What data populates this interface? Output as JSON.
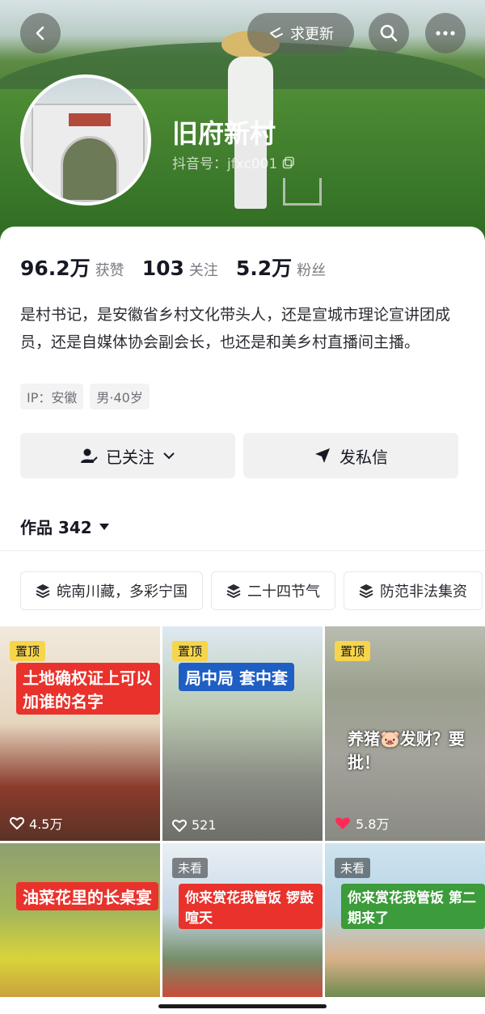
{
  "header": {
    "update_label": "求更新",
    "name": "旧府新村",
    "douyin_id": "抖音号：jfxc001"
  },
  "stats": [
    {
      "num": "96.2万",
      "label": "获赞"
    },
    {
      "num": "103",
      "label": "关注"
    },
    {
      "num": "5.2万",
      "label": "粉丝"
    }
  ],
  "bio": {
    "text": "是村书记，是安徽省乡村文化带头人，还是宣城市理论宣讲团成员，还是自媒体协会副会长，也还是和美乡村直播间主播。",
    "tags": [
      "IP：安徽",
      "男·40岁"
    ]
  },
  "actions": {
    "follow": "已关注",
    "message": "发私信"
  },
  "works": {
    "label": "作品 342"
  },
  "collections": [
    "皖南川藏，多彩宁国",
    "二十四节气",
    "防范非法集资"
  ],
  "videos": [
    {
      "badge": "置顶",
      "caption": "土地确权证上可以加谁的名字",
      "likes": "4.5万",
      "liked": false
    },
    {
      "badge": "置顶",
      "caption": "局中局 套中套",
      "likes": "521",
      "liked": false
    },
    {
      "badge": "置顶",
      "caption": "养猪🐷发财？要批！",
      "likes": "5.8万",
      "liked": true
    },
    {
      "badge": "",
      "caption": "油菜花里的长桌宴",
      "likes": "",
      "liked": false
    },
    {
      "badge": "未看",
      "caption": "你来赏花我管饭 锣鼓喧天",
      "likes": "",
      "liked": false
    },
    {
      "badge": "未看",
      "caption": "你来赏花我管饭 第二期来了",
      "likes": "",
      "liked": false
    }
  ],
  "colors": {
    "badge": "#f7d54a",
    "liked": "#fe2c55"
  }
}
